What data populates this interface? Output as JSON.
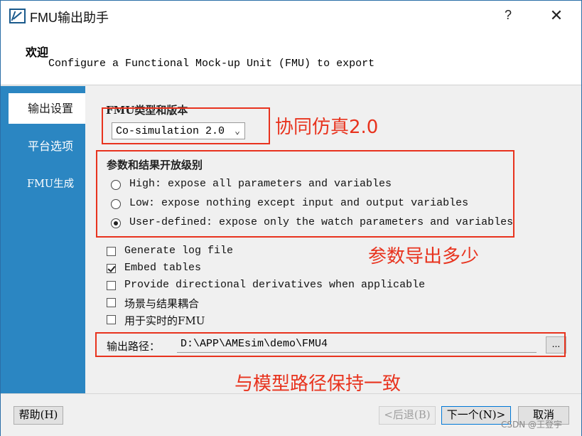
{
  "window": {
    "title": "FMU输出助手",
    "help_label": "?",
    "close_label": "✕"
  },
  "header": {
    "title": "欢迎",
    "subtitle": "Configure a Functional Mock-up Unit (FMU) to export"
  },
  "nav": {
    "items": [
      {
        "label": "输出设置",
        "active": true
      },
      {
        "label": "平台选项",
        "active": false
      },
      {
        "label": "FMU生成",
        "active": false
      }
    ]
  },
  "fmu_type": {
    "group_label": "FMU类型和版本",
    "selected": "Co-simulation 2.0",
    "arrow": "⌄"
  },
  "exposure": {
    "group_label": "参数和结果开放级别",
    "options": [
      {
        "label": "High: expose all parameters and variables",
        "checked": false
      },
      {
        "label": "Low: expose nothing except input and output variables",
        "checked": false
      },
      {
        "label": "User-defined: expose only the watch parameters and variables",
        "checked": true
      }
    ]
  },
  "checkboxes": [
    {
      "label": "Generate log file",
      "checked": false
    },
    {
      "label": "Embed tables",
      "checked": true
    },
    {
      "label": "Provide directional derivatives when applicable",
      "checked": false
    },
    {
      "label": "场景与结果耦合",
      "checked": false
    },
    {
      "label": "用于实时的FMU",
      "checked": false
    }
  ],
  "output_path": {
    "label": "输出路径：",
    "value": "D:\\APP\\AMEsim\\demo\\FMU4",
    "browse_label": "..."
  },
  "footer": {
    "help": "帮助(H)",
    "back": "<后退(B)",
    "next": "下一个(N)>",
    "cancel": "取消"
  },
  "annotations": {
    "cosim": "协同仿真2.0",
    "params": "参数导出多少",
    "path": "与模型路径保持一致",
    "color": "#e8331e"
  },
  "watermark": "CSDN @王登宇"
}
